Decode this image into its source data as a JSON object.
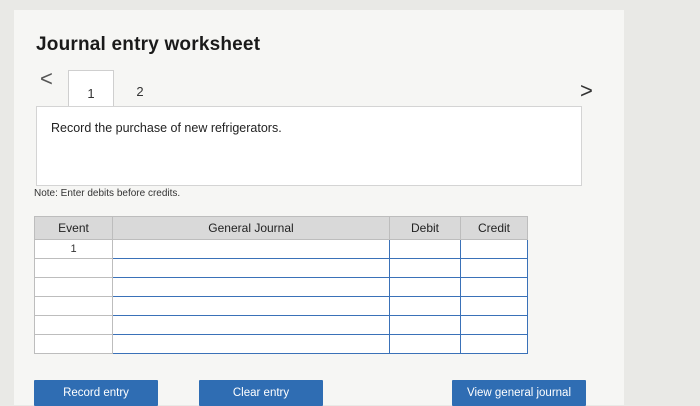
{
  "worksheet": {
    "title": "Journal entry worksheet",
    "tabs": [
      {
        "label": "1",
        "active": true
      },
      {
        "label": "2",
        "active": false
      }
    ],
    "prev_icon": "<",
    "next_icon": ">",
    "description": "Record the purchase of new refrigerators.",
    "note": "Note: Enter debits before credits."
  },
  "table": {
    "headers": {
      "event": "Event",
      "general_journal": "General Journal",
      "debit": "Debit",
      "credit": "Credit"
    },
    "rows": [
      {
        "event": "1",
        "account": "",
        "debit": "",
        "credit": ""
      },
      {
        "event": "",
        "account": "",
        "debit": "",
        "credit": ""
      },
      {
        "event": "",
        "account": "",
        "debit": "",
        "credit": ""
      },
      {
        "event": "",
        "account": "",
        "debit": "",
        "credit": ""
      },
      {
        "event": "",
        "account": "",
        "debit": "",
        "credit": ""
      },
      {
        "event": "",
        "account": "",
        "debit": "",
        "credit": ""
      }
    ]
  },
  "buttons": {
    "record_entry": "Record entry",
    "clear_entry": "Clear entry",
    "view_general_journal": "View general journal"
  },
  "colors": {
    "button_bg": "#2f6db3",
    "input_border": "#3a71b8",
    "header_bg": "#d9d9d9"
  }
}
